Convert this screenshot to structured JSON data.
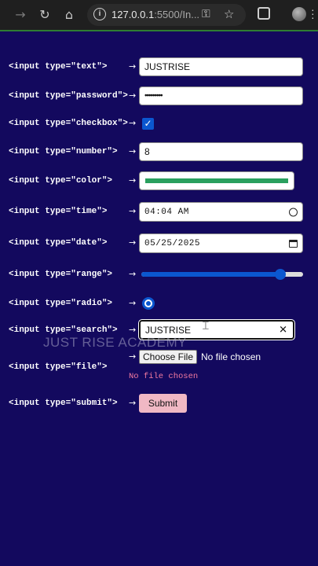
{
  "browser": {
    "url_host": "127.0.0.1",
    "url_rest": ":5500/In..."
  },
  "rows": [
    {
      "label": "<input type=\"text\">",
      "arrow": "→",
      "value": "JUSTRISE"
    },
    {
      "label": "<input type=\"password\">",
      "arrow": "→",
      "value": "•••••••••"
    },
    {
      "label": "<input type=\"checkbox\">",
      "arrow": "→",
      "checked": true
    },
    {
      "label": "<input type=\"number\">",
      "arrow": "→",
      "value": "8"
    },
    {
      "label": "<input type=\"color\">",
      "arrow": "→",
      "color": "#2aa05e"
    },
    {
      "label": "<input type=\"time\">",
      "arrow": "→",
      "value": "04:04 AM"
    },
    {
      "label": "<input type=\"date\">",
      "arrow": "→",
      "value": "05/25/2025"
    },
    {
      "label": "<input type=\"range\">",
      "arrow": "→",
      "fraction": 0.86
    },
    {
      "label": "<input type=\"radio\">",
      "arrow": "→",
      "selected": true
    },
    {
      "label": "<input type=\"search\">",
      "arrow": "→",
      "value": "JUSTRISE"
    },
    {
      "label": "<input type=\"file\">",
      "arrow": "→",
      "button": "Choose File",
      "status": "No file chosen",
      "message": "No file chosen"
    },
    {
      "label": "<input type=\"submit\">",
      "arrow": "→",
      "button": "Submit"
    }
  ],
  "watermark": "JUST RISE ACADEMY",
  "colors": {
    "background": "#13095e",
    "accent": "#0b57d0",
    "color_swatch": "#2aa05e",
    "submit_bg": "#f0b8c4",
    "file_message": "#f27aa0"
  }
}
